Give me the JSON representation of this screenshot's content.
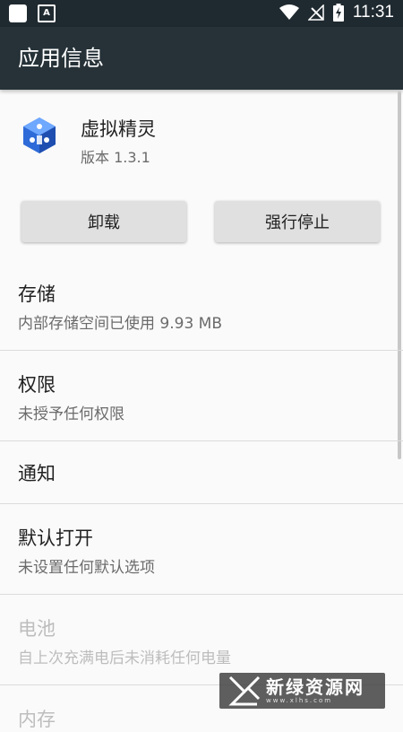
{
  "status_bar": {
    "time": "11:31"
  },
  "toolbar": {
    "title": "应用信息"
  },
  "app": {
    "name": "虚拟精灵",
    "version": "版本 1.3.1"
  },
  "buttons": {
    "uninstall": "卸载",
    "force_stop": "强行停止"
  },
  "items": [
    {
      "title": "存储",
      "subtitle": "内部存储空间已使用 9.93 MB",
      "enabled": true
    },
    {
      "title": "权限",
      "subtitle": "未授予任何权限",
      "enabled": true
    },
    {
      "title": "通知",
      "subtitle": "",
      "enabled": true
    },
    {
      "title": "默认打开",
      "subtitle": "未设置任何默认选项",
      "enabled": true
    },
    {
      "title": "电池",
      "subtitle": "自上次充满电后未消耗任何电量",
      "enabled": false
    },
    {
      "title": "内存",
      "subtitle": "",
      "enabled": false
    }
  ],
  "watermark": {
    "text": "新绿资源网",
    "url": "www.xlhs.com"
  },
  "colors": {
    "status_bar": "#1f2a30",
    "toolbar": "#263238",
    "background": "#fafafa",
    "icon_blue": "#2f6bd8"
  }
}
